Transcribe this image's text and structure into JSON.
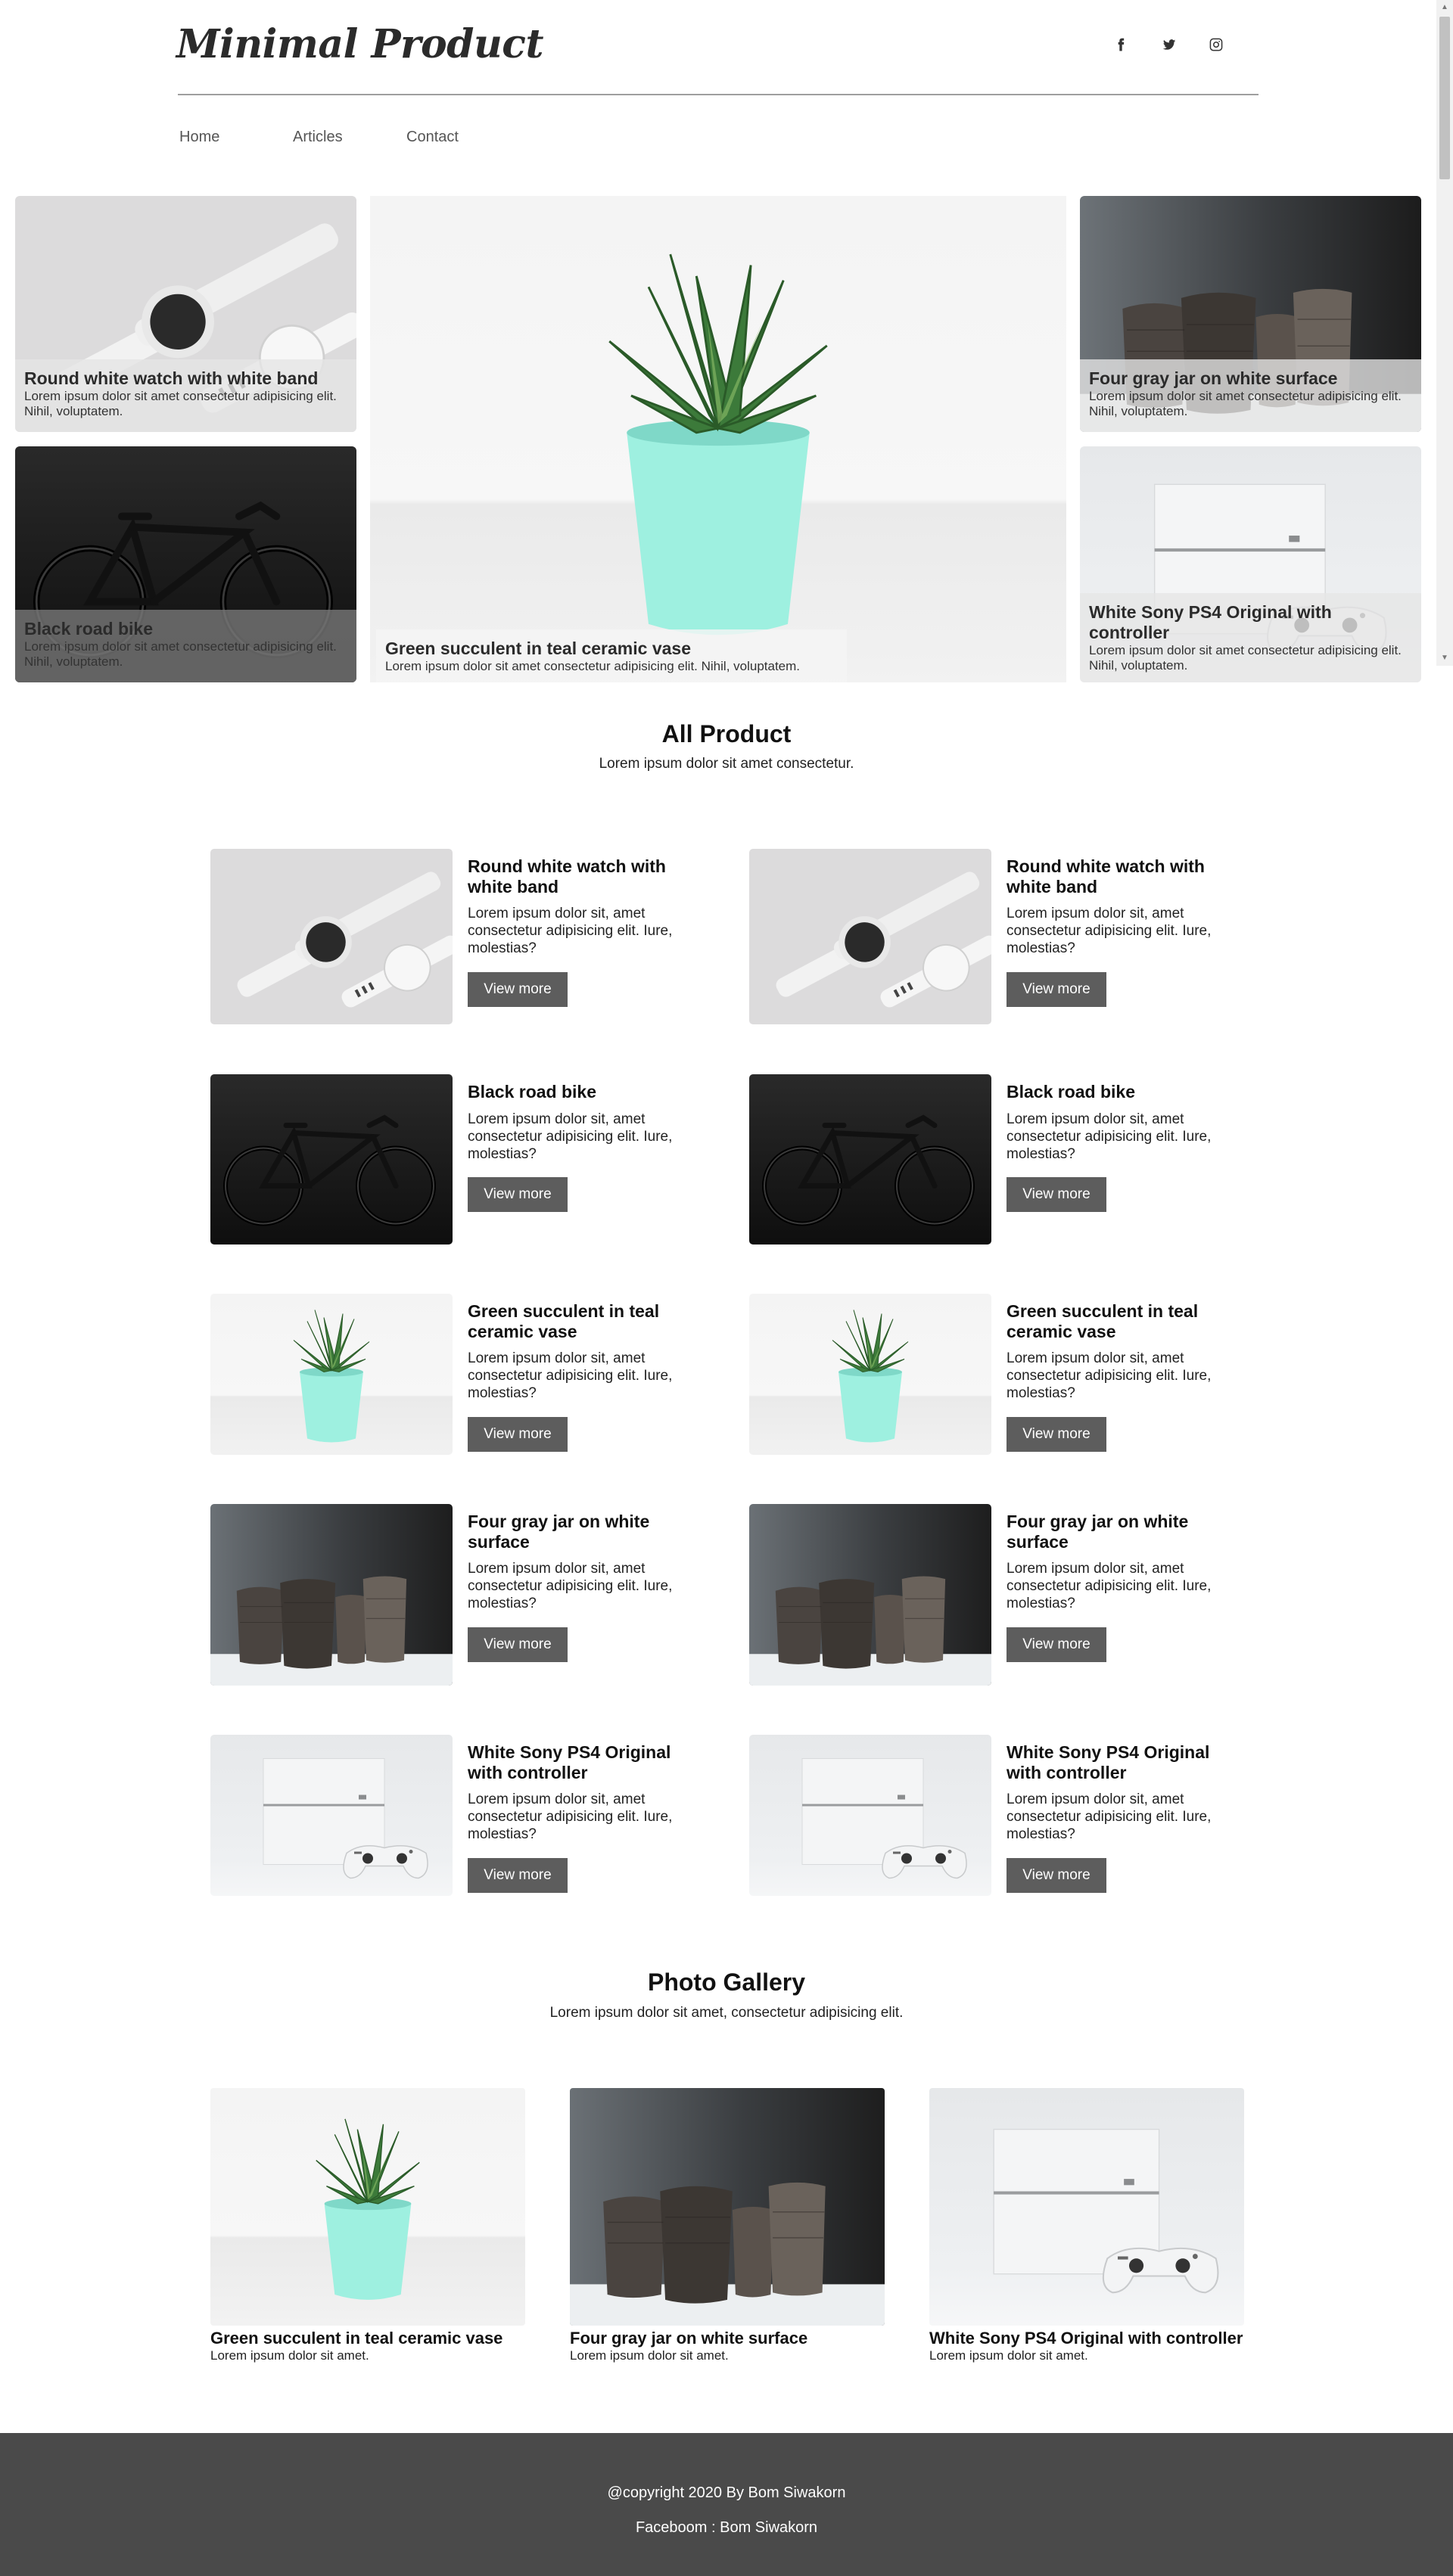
{
  "header": {
    "logo": "Minimal Product",
    "social": [
      "facebook-icon",
      "twitter-icon",
      "instagram-icon"
    ]
  },
  "nav": [
    "Home",
    "Articles",
    "Contact"
  ],
  "hero": {
    "cards": [
      {
        "title": "Round white watch with white band",
        "text": "Lorem ipsum dolor sit amet consectetur adipisicing elit. Nihil, voluptatem."
      },
      {
        "title": "Black road bike",
        "text": "Lorem ipsum dolor sit amet consectetur adipisicing elit. Nihil, voluptatem."
      },
      {
        "title": "Green succulent in teal ceramic vase",
        "text": "Lorem ipsum dolor sit amet consectetur adipisicing elit. Nihil, voluptatem."
      },
      {
        "title": "Four gray jar on white surface",
        "text": "Lorem ipsum dolor sit amet consectetur adipisicing elit. Nihil, voluptatem."
      },
      {
        "title": "White Sony PS4 Original with controller",
        "text": "Lorem ipsum dolor sit amet consectetur adipisicing elit. Nihil, voluptatem."
      }
    ]
  },
  "all_product": {
    "title": "All Product",
    "subtitle": "Lorem ipsum dolor sit amet consectetur.",
    "button_label": "View more",
    "items": [
      {
        "title": "Round white watch with white band",
        "text": "Lorem ipsum dolor sit, amet consectetur adipisicing elit. Iure, molestias?"
      },
      {
        "title": "Black road bike",
        "text": "Lorem ipsum dolor sit, amet consectetur adipisicing elit. Iure, molestias?"
      },
      {
        "title": "Green succulent in teal ceramic vase",
        "text": "Lorem ipsum dolor sit, amet consectetur adipisicing elit. Iure, molestias?"
      },
      {
        "title": "Four gray jar on white surface",
        "text": "Lorem ipsum dolor sit, amet consectetur adipisicing elit. Iure, molestias?"
      },
      {
        "title": "White Sony PS4 Original with controller",
        "text": "Lorem ipsum dolor sit, amet consectetur adipisicing elit. Iure, molestias?"
      }
    ]
  },
  "gallery": {
    "title": "Photo Gallery",
    "subtitle": "Lorem ipsum dolor sit amet, consectetur adipisicing elit.",
    "items": [
      {
        "title": "Green succulent in teal ceramic vase",
        "text": "Lorem ipsum dolor sit amet."
      },
      {
        "title": "Four gray jar on white surface",
        "text": "Lorem ipsum dolor sit amet."
      },
      {
        "title": "White Sony PS4 Original with controller",
        "text": "Lorem ipsum dolor sit amet."
      }
    ]
  },
  "footer": {
    "copyright": "@copyright 2020 By Bom Siwakorn",
    "facebook": "Faceboom : Bom Siwakorn"
  },
  "colors": {
    "button_bg": "#5d5d5d",
    "footer_bg": "#4a4a4a",
    "vase_teal": "#9ef0e0"
  }
}
